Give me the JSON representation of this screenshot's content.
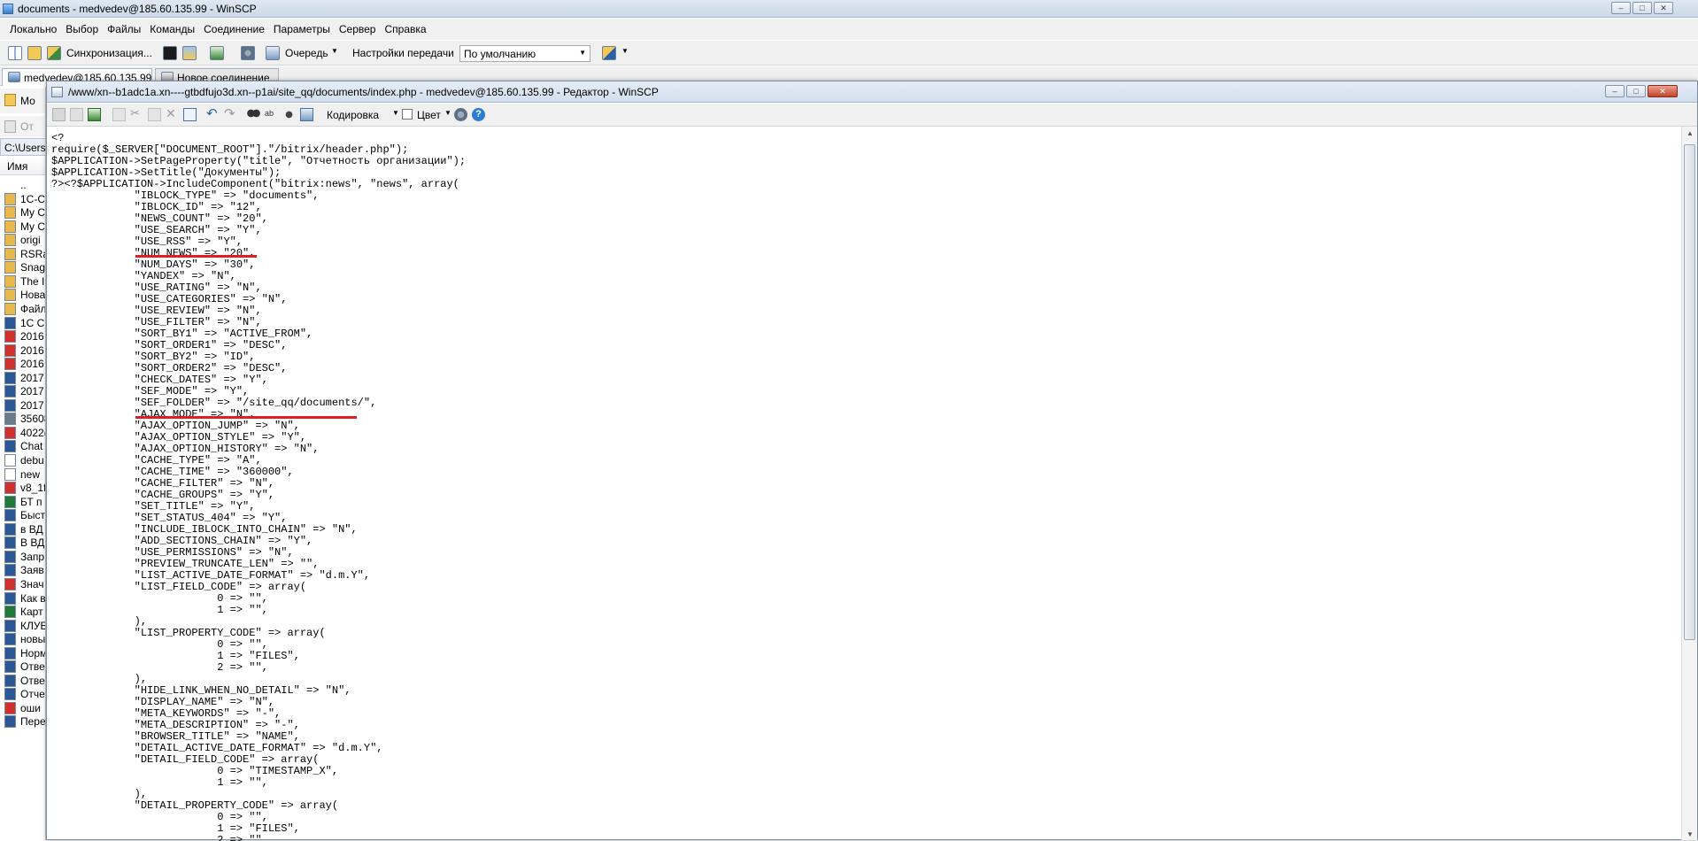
{
  "window": {
    "title": "documents - medvedev@185.60.135.99 - WinSCP"
  },
  "menu": [
    "Локально",
    "Выбор",
    "Файлы",
    "Команды",
    "Соединение",
    "Параметры",
    "Сервер",
    "Справка"
  ],
  "toolbar": {
    "sync_label": "Синхронизация...",
    "queue_label": "Очередь",
    "transfer_settings_label": "Настройки передачи",
    "transfer_preset": "По умолчанию"
  },
  "session_tabs": {
    "active": "medvedev@185.60.135.99",
    "new": "Новое соединение..."
  },
  "left_panel": {
    "path": "C:\\Users",
    "column_name": "Имя",
    "items": [
      "..",
      "1C-C",
      "My C",
      "My C",
      "origi",
      "RSRa",
      "Snag",
      "The I",
      "Нова",
      "Файл",
      "1C C",
      "2016",
      "2016",
      "2016",
      "2017",
      "2017",
      "2017",
      "35608",
      "4022(",
      "Chat",
      "debu",
      "new",
      "v8_1f",
      "БТ п",
      "Быст",
      "в ВД",
      "В ВД",
      "Запр",
      "Заяв",
      "Знач",
      "Как в",
      "Карт",
      "КЛУБ",
      "новы",
      "Норм",
      "Отве",
      "Отве",
      "Отче",
      "оши",
      "Пере"
    ],
    "icon_types": [
      "up",
      "folder",
      "folder",
      "folder",
      "folder",
      "folder",
      "folder",
      "folder",
      "folder",
      "folder",
      "word",
      "pdfred",
      "pdfred",
      "pdfred",
      "word",
      "word",
      "word",
      "doc",
      "pdf",
      "word",
      "file",
      "file",
      "pdf",
      "excel",
      "word",
      "word",
      "word",
      "word",
      "word",
      "pdf",
      "word",
      "excel",
      "word",
      "word",
      "word",
      "word",
      "word",
      "word",
      "pdfred",
      "word"
    ]
  },
  "editor": {
    "title": "/www/xn--b1adc1a.xn----gtbdfujo3d.xn--p1ai/site_qq/documents/index.php - medvedev@185.60.135.99 - Редактор - WinSCP",
    "encoding_label": "Кодировка",
    "color_label": "Цвет",
    "code": "<?\nrequire($_SERVER[\"DOCUMENT_ROOT\"].\"/bitrix/header.php\");\n$APPLICATION->SetPageProperty(\"title\", \"Отчетность организации\");\n$APPLICATION->SetTitle(\"Документы\");\n?><?$APPLICATION->IncludeComponent(\"bitrix:news\", \"news\", array(\n\t\"IBLOCK_TYPE\" => \"documents\",\n\t\"IBLOCK_ID\" => \"12\",\n\t\"NEWS_COUNT\" => \"20\",\n\t\"USE_SEARCH\" => \"Y\",\n\t\"USE_RSS\" => \"Y\",\n\t\"NUM_NEWS\" => \"20\",\n\t\"NUM_DAYS\" => \"30\",\n\t\"YANDEX\" => \"N\",\n\t\"USE_RATING\" => \"N\",\n\t\"USE_CATEGORIES\" => \"N\",\n\t\"USE_REVIEW\" => \"N\",\n\t\"USE_FILTER\" => \"N\",\n\t\"SORT_BY1\" => \"ACTIVE_FROM\",\n\t\"SORT_ORDER1\" => \"DESC\",\n\t\"SORT_BY2\" => \"ID\",\n\t\"SORT_ORDER2\" => \"DESC\",\n\t\"CHECK_DATES\" => \"Y\",\n\t\"SEF_MODE\" => \"Y\",\n\t\"SEF_FOLDER\" => \"/site_qq/documents/\",\n\t\"AJAX_MODE\" => \"N\",\n\t\"AJAX_OPTION_JUMP\" => \"N\",\n\t\"AJAX_OPTION_STYLE\" => \"Y\",\n\t\"AJAX_OPTION_HISTORY\" => \"N\",\n\t\"CACHE_TYPE\" => \"A\",\n\t\"CACHE_TIME\" => \"360000\",\n\t\"CACHE_FILTER\" => \"N\",\n\t\"CACHE_GROUPS\" => \"Y\",\n\t\"SET_TITLE\" => \"Y\",\n\t\"SET_STATUS_404\" => \"Y\",\n\t\"INCLUDE_IBLOCK_INTO_CHAIN\" => \"N\",\n\t\"ADD_SECTIONS_CHAIN\" => \"Y\",\n\t\"USE_PERMISSIONS\" => \"N\",\n\t\"PREVIEW_TRUNCATE_LEN\" => \"\",\n\t\"LIST_ACTIVE_DATE_FORMAT\" => \"d.m.Y\",\n\t\"LIST_FIELD_CODE\" => array(\n\t\t0 => \"\",\n\t\t1 => \"\",\n\t),\n\t\"LIST_PROPERTY_CODE\" => array(\n\t\t0 => \"\",\n\t\t1 => \"FILES\",\n\t\t2 => \"\",\n\t),\n\t\"HIDE_LINK_WHEN_NO_DETAIL\" => \"N\",\n\t\"DISPLAY_NAME\" => \"N\",\n\t\"META_KEYWORDS\" => \"-\",\n\t\"META_DESCRIPTION\" => \"-\",\n\t\"BROWSER_TITLE\" => \"NAME\",\n\t\"DETAIL_ACTIVE_DATE_FORMAT\" => \"d.m.Y\",\n\t\"DETAIL_FIELD_CODE\" => array(\n\t\t0 => \"TIMESTAMP_X\",\n\t\t1 => \"\",\n\t),\n\t\"DETAIL_PROPERTY_CODE\" => array(\n\t\t0 => \"\",\n\t\t1 => \"FILES\",\n\t\t2 => \"\","
  },
  "colors": {
    "annotation": "#e02020",
    "word": "#2b5797",
    "excel": "#1f7a3a",
    "pdf": "#d0312d",
    "folder": "#e8b94a"
  }
}
